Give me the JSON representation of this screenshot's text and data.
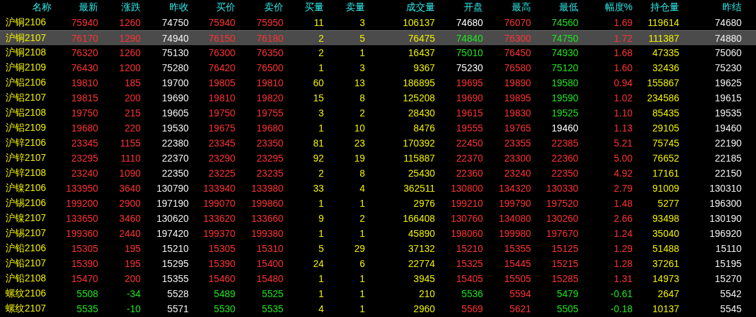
{
  "columns": [
    {
      "label": "名称",
      "kind": "name"
    },
    {
      "label": "最新",
      "kind": "price"
    },
    {
      "label": "涨跌",
      "kind": "price"
    },
    {
      "label": "昨收",
      "kind": "reference"
    },
    {
      "label": "买价",
      "kind": "price"
    },
    {
      "label": "卖价",
      "kind": "price"
    },
    {
      "label": "买量",
      "kind": "volume"
    },
    {
      "label": "卖量",
      "kind": "volume"
    },
    {
      "label": "成交量",
      "kind": "volume"
    },
    {
      "label": "开盘",
      "kind": "price"
    },
    {
      "label": "最高",
      "kind": "price"
    },
    {
      "label": "最低",
      "kind": "price"
    },
    {
      "label": "幅度%",
      "kind": "price"
    },
    {
      "label": "持仓量",
      "kind": "volume"
    },
    {
      "label": "昨结",
      "kind": "reference"
    }
  ],
  "rows": [
    {
      "selected": false,
      "cells": [
        {
          "text": "沪铜2106"
        },
        {
          "text": "75940",
          "color": "#ff3232"
        },
        {
          "text": "1260",
          "color": "#ff3232"
        },
        {
          "text": "74750"
        },
        {
          "text": "75940",
          "color": "#ff3232"
        },
        {
          "text": "75950",
          "color": "#ff3232"
        },
        {
          "text": "11"
        },
        {
          "text": "3"
        },
        {
          "text": "106137"
        },
        {
          "text": "74680",
          "color": "#ffffff"
        },
        {
          "text": "76070",
          "color": "#ff3232"
        },
        {
          "text": "74560",
          "color": "#1ee61e"
        },
        {
          "text": "1.69",
          "color": "#ff3232"
        },
        {
          "text": "119614"
        },
        {
          "text": "74680"
        }
      ]
    },
    {
      "selected": true,
      "cells": [
        {
          "text": "沪铜2107"
        },
        {
          "text": "76170",
          "color": "#ff3232"
        },
        {
          "text": "1290",
          "color": "#ff3232"
        },
        {
          "text": "74940"
        },
        {
          "text": "76150",
          "color": "#ff3232"
        },
        {
          "text": "76180",
          "color": "#ff3232"
        },
        {
          "text": "2"
        },
        {
          "text": "5"
        },
        {
          "text": "76475"
        },
        {
          "text": "74840",
          "color": "#1ee61e"
        },
        {
          "text": "76300",
          "color": "#ff3232"
        },
        {
          "text": "74750",
          "color": "#1ee61e"
        },
        {
          "text": "1.72",
          "color": "#ff3232"
        },
        {
          "text": "111387"
        },
        {
          "text": "74880"
        }
      ]
    },
    {
      "selected": false,
      "cells": [
        {
          "text": "沪铜2108"
        },
        {
          "text": "76320",
          "color": "#ff3232"
        },
        {
          "text": "1260",
          "color": "#ff3232"
        },
        {
          "text": "75130"
        },
        {
          "text": "76300",
          "color": "#ff3232"
        },
        {
          "text": "76350",
          "color": "#ff3232"
        },
        {
          "text": "2"
        },
        {
          "text": "1"
        },
        {
          "text": "16437"
        },
        {
          "text": "75010",
          "color": "#1ee61e"
        },
        {
          "text": "76450",
          "color": "#ff3232"
        },
        {
          "text": "74930",
          "color": "#1ee61e"
        },
        {
          "text": "1.68",
          "color": "#ff3232"
        },
        {
          "text": "47335"
        },
        {
          "text": "75060"
        }
      ]
    },
    {
      "selected": false,
      "cells": [
        {
          "text": "沪铜2109"
        },
        {
          "text": "76430",
          "color": "#ff3232"
        },
        {
          "text": "1200",
          "color": "#ff3232"
        },
        {
          "text": "75280"
        },
        {
          "text": "76420",
          "color": "#ff3232"
        },
        {
          "text": "76500",
          "color": "#ff3232"
        },
        {
          "text": "1"
        },
        {
          "text": "3"
        },
        {
          "text": "9367"
        },
        {
          "text": "75230",
          "color": "#ffffff"
        },
        {
          "text": "76580",
          "color": "#ff3232"
        },
        {
          "text": "75120",
          "color": "#1ee61e"
        },
        {
          "text": "1.60",
          "color": "#ff3232"
        },
        {
          "text": "32436"
        },
        {
          "text": "75230"
        }
      ]
    },
    {
      "selected": false,
      "cells": [
        {
          "text": "沪铝2106"
        },
        {
          "text": "19810",
          "color": "#ff3232"
        },
        {
          "text": "185",
          "color": "#ff3232"
        },
        {
          "text": "19700"
        },
        {
          "text": "19805",
          "color": "#ff3232"
        },
        {
          "text": "19810",
          "color": "#ff3232"
        },
        {
          "text": "60"
        },
        {
          "text": "13"
        },
        {
          "text": "186895"
        },
        {
          "text": "19695",
          "color": "#ff3232"
        },
        {
          "text": "19890",
          "color": "#ff3232"
        },
        {
          "text": "19580",
          "color": "#1ee61e"
        },
        {
          "text": "0.94",
          "color": "#ff3232"
        },
        {
          "text": "155867"
        },
        {
          "text": "19625"
        }
      ]
    },
    {
      "selected": false,
      "cells": [
        {
          "text": "沪铝2107"
        },
        {
          "text": "19815",
          "color": "#ff3232"
        },
        {
          "text": "200",
          "color": "#ff3232"
        },
        {
          "text": "19690"
        },
        {
          "text": "19810",
          "color": "#ff3232"
        },
        {
          "text": "19820",
          "color": "#ff3232"
        },
        {
          "text": "15"
        },
        {
          "text": "8"
        },
        {
          "text": "125208"
        },
        {
          "text": "19690",
          "color": "#ff3232"
        },
        {
          "text": "19895",
          "color": "#ff3232"
        },
        {
          "text": "19590",
          "color": "#1ee61e"
        },
        {
          "text": "1.02",
          "color": "#ff3232"
        },
        {
          "text": "234586"
        },
        {
          "text": "19615"
        }
      ]
    },
    {
      "selected": false,
      "cells": [
        {
          "text": "沪铝2108"
        },
        {
          "text": "19750",
          "color": "#ff3232"
        },
        {
          "text": "215",
          "color": "#ff3232"
        },
        {
          "text": "19605"
        },
        {
          "text": "19750",
          "color": "#ff3232"
        },
        {
          "text": "19755",
          "color": "#ff3232"
        },
        {
          "text": "3"
        },
        {
          "text": "2"
        },
        {
          "text": "28430"
        },
        {
          "text": "19615",
          "color": "#ff3232"
        },
        {
          "text": "19830",
          "color": "#ff3232"
        },
        {
          "text": "19525",
          "color": "#1ee61e"
        },
        {
          "text": "1.10",
          "color": "#ff3232"
        },
        {
          "text": "85435"
        },
        {
          "text": "19535"
        }
      ]
    },
    {
      "selected": false,
      "cells": [
        {
          "text": "沪铝2109"
        },
        {
          "text": "19680",
          "color": "#ff3232"
        },
        {
          "text": "220",
          "color": "#ff3232"
        },
        {
          "text": "19530"
        },
        {
          "text": "19675",
          "color": "#ff3232"
        },
        {
          "text": "19680",
          "color": "#ff3232"
        },
        {
          "text": "1"
        },
        {
          "text": "10"
        },
        {
          "text": "8476"
        },
        {
          "text": "19555",
          "color": "#ff3232"
        },
        {
          "text": "19765",
          "color": "#ff3232"
        },
        {
          "text": "19460",
          "color": "#ffffff"
        },
        {
          "text": "1.13",
          "color": "#ff3232"
        },
        {
          "text": "29105"
        },
        {
          "text": "19460"
        }
      ]
    },
    {
      "selected": false,
      "cells": [
        {
          "text": "沪锌2106"
        },
        {
          "text": "23345",
          "color": "#ff3232"
        },
        {
          "text": "1155",
          "color": "#ff3232"
        },
        {
          "text": "22380"
        },
        {
          "text": "23345",
          "color": "#ff3232"
        },
        {
          "text": "23350",
          "color": "#ff3232"
        },
        {
          "text": "81"
        },
        {
          "text": "23"
        },
        {
          "text": "170392"
        },
        {
          "text": "22450",
          "color": "#ff3232"
        },
        {
          "text": "23355",
          "color": "#ff3232"
        },
        {
          "text": "22385",
          "color": "#ff3232"
        },
        {
          "text": "5.21",
          "color": "#ff3232"
        },
        {
          "text": "75745"
        },
        {
          "text": "22190"
        }
      ]
    },
    {
      "selected": false,
      "cells": [
        {
          "text": "沪锌2107"
        },
        {
          "text": "23295",
          "color": "#ff3232"
        },
        {
          "text": "1110",
          "color": "#ff3232"
        },
        {
          "text": "22370"
        },
        {
          "text": "23290",
          "color": "#ff3232"
        },
        {
          "text": "23295",
          "color": "#ff3232"
        },
        {
          "text": "92"
        },
        {
          "text": "19"
        },
        {
          "text": "115887"
        },
        {
          "text": "22370",
          "color": "#ff3232"
        },
        {
          "text": "23300",
          "color": "#ff3232"
        },
        {
          "text": "22360",
          "color": "#ff3232"
        },
        {
          "text": "5.00",
          "color": "#ff3232"
        },
        {
          "text": "76652"
        },
        {
          "text": "22185"
        }
      ]
    },
    {
      "selected": false,
      "cells": [
        {
          "text": "沪锌2108"
        },
        {
          "text": "23240",
          "color": "#ff3232"
        },
        {
          "text": "1090",
          "color": "#ff3232"
        },
        {
          "text": "22350"
        },
        {
          "text": "23225",
          "color": "#ff3232"
        },
        {
          "text": "23235",
          "color": "#ff3232"
        },
        {
          "text": "2"
        },
        {
          "text": "8"
        },
        {
          "text": "25430"
        },
        {
          "text": "22360",
          "color": "#ff3232"
        },
        {
          "text": "23240",
          "color": "#ff3232"
        },
        {
          "text": "22350",
          "color": "#ff3232"
        },
        {
          "text": "4.92",
          "color": "#ff3232"
        },
        {
          "text": "17161"
        },
        {
          "text": "22150"
        }
      ]
    },
    {
      "selected": false,
      "cells": [
        {
          "text": "沪镍2106"
        },
        {
          "text": "133950",
          "color": "#ff3232"
        },
        {
          "text": "3640",
          "color": "#ff3232"
        },
        {
          "text": "130790"
        },
        {
          "text": "133940",
          "color": "#ff3232"
        },
        {
          "text": "133980",
          "color": "#ff3232"
        },
        {
          "text": "33"
        },
        {
          "text": "4"
        },
        {
          "text": "362511"
        },
        {
          "text": "130800",
          "color": "#ff3232"
        },
        {
          "text": "134320",
          "color": "#ff3232"
        },
        {
          "text": "130330",
          "color": "#ff3232"
        },
        {
          "text": "2.79",
          "color": "#ff3232"
        },
        {
          "text": "91009"
        },
        {
          "text": "130310"
        }
      ]
    },
    {
      "selected": false,
      "cells": [
        {
          "text": "沪锡2106"
        },
        {
          "text": "199200",
          "color": "#ff3232"
        },
        {
          "text": "2900",
          "color": "#ff3232"
        },
        {
          "text": "197190"
        },
        {
          "text": "199070",
          "color": "#ff3232"
        },
        {
          "text": "199860",
          "color": "#ff3232"
        },
        {
          "text": "1"
        },
        {
          "text": "1"
        },
        {
          "text": "2976"
        },
        {
          "text": "199210",
          "color": "#ff3232"
        },
        {
          "text": "199790",
          "color": "#ff3232"
        },
        {
          "text": "197520",
          "color": "#ff3232"
        },
        {
          "text": "1.48",
          "color": "#ff3232"
        },
        {
          "text": "5277"
        },
        {
          "text": "196300"
        }
      ]
    },
    {
      "selected": false,
      "cells": [
        {
          "text": "沪镍2107"
        },
        {
          "text": "133650",
          "color": "#ff3232"
        },
        {
          "text": "3460",
          "color": "#ff3232"
        },
        {
          "text": "130620"
        },
        {
          "text": "133620",
          "color": "#ff3232"
        },
        {
          "text": "133660",
          "color": "#ff3232"
        },
        {
          "text": "9"
        },
        {
          "text": "2"
        },
        {
          "text": "166408"
        },
        {
          "text": "130760",
          "color": "#ff3232"
        },
        {
          "text": "134080",
          "color": "#ff3232"
        },
        {
          "text": "130260",
          "color": "#ff3232"
        },
        {
          "text": "2.66",
          "color": "#ff3232"
        },
        {
          "text": "93498"
        },
        {
          "text": "130190"
        }
      ]
    },
    {
      "selected": false,
      "cells": [
        {
          "text": "沪锡2107"
        },
        {
          "text": "199360",
          "color": "#ff3232"
        },
        {
          "text": "2440",
          "color": "#ff3232"
        },
        {
          "text": "197420"
        },
        {
          "text": "199370",
          "color": "#ff3232"
        },
        {
          "text": "199380",
          "color": "#ff3232"
        },
        {
          "text": "1"
        },
        {
          "text": "1"
        },
        {
          "text": "45890"
        },
        {
          "text": "198060",
          "color": "#ff3232"
        },
        {
          "text": "199980",
          "color": "#ff3232"
        },
        {
          "text": "197670",
          "color": "#ff3232"
        },
        {
          "text": "1.24",
          "color": "#ff3232"
        },
        {
          "text": "35040"
        },
        {
          "text": "196920"
        }
      ]
    },
    {
      "selected": false,
      "cells": [
        {
          "text": "沪铅2106"
        },
        {
          "text": "15305",
          "color": "#ff3232"
        },
        {
          "text": "195",
          "color": "#ff3232"
        },
        {
          "text": "15210"
        },
        {
          "text": "15305",
          "color": "#ff3232"
        },
        {
          "text": "15310",
          "color": "#ff3232"
        },
        {
          "text": "5"
        },
        {
          "text": "29"
        },
        {
          "text": "37132"
        },
        {
          "text": "15210",
          "color": "#ff3232"
        },
        {
          "text": "15355",
          "color": "#ff3232"
        },
        {
          "text": "15125",
          "color": "#ff3232"
        },
        {
          "text": "1.29",
          "color": "#ff3232"
        },
        {
          "text": "51488"
        },
        {
          "text": "15110"
        }
      ]
    },
    {
      "selected": false,
      "cells": [
        {
          "text": "沪铅2107"
        },
        {
          "text": "15390",
          "color": "#ff3232"
        },
        {
          "text": "195",
          "color": "#ff3232"
        },
        {
          "text": "15295"
        },
        {
          "text": "15390",
          "color": "#ff3232"
        },
        {
          "text": "15400",
          "color": "#ff3232"
        },
        {
          "text": "24"
        },
        {
          "text": "6"
        },
        {
          "text": "22774"
        },
        {
          "text": "15325",
          "color": "#ff3232"
        },
        {
          "text": "15445",
          "color": "#ff3232"
        },
        {
          "text": "15215",
          "color": "#ff3232"
        },
        {
          "text": "1.28",
          "color": "#ff3232"
        },
        {
          "text": "37261"
        },
        {
          "text": "15195"
        }
      ]
    },
    {
      "selected": false,
      "cells": [
        {
          "text": "沪铅2108"
        },
        {
          "text": "15470",
          "color": "#ff3232"
        },
        {
          "text": "200",
          "color": "#ff3232"
        },
        {
          "text": "15355"
        },
        {
          "text": "15460",
          "color": "#ff3232"
        },
        {
          "text": "15480",
          "color": "#ff3232"
        },
        {
          "text": "1"
        },
        {
          "text": "1"
        },
        {
          "text": "3945"
        },
        {
          "text": "15405",
          "color": "#ff3232"
        },
        {
          "text": "15505",
          "color": "#ff3232"
        },
        {
          "text": "15285",
          "color": "#ff3232"
        },
        {
          "text": "1.31",
          "color": "#ff3232"
        },
        {
          "text": "14973"
        },
        {
          "text": "15270"
        }
      ]
    },
    {
      "selected": false,
      "cells": [
        {
          "text": "螺纹2106"
        },
        {
          "text": "5508",
          "color": "#1ee61e"
        },
        {
          "text": "-34",
          "color": "#1ee61e"
        },
        {
          "text": "5528"
        },
        {
          "text": "5489",
          "color": "#1ee61e"
        },
        {
          "text": "5525",
          "color": "#1ee61e"
        },
        {
          "text": "1"
        },
        {
          "text": "1"
        },
        {
          "text": "210"
        },
        {
          "text": "5536",
          "color": "#1ee61e"
        },
        {
          "text": "5594",
          "color": "#ff3232"
        },
        {
          "text": "5479",
          "color": "#1ee61e"
        },
        {
          "text": "-0.61",
          "color": "#1ee61e"
        },
        {
          "text": "2647"
        },
        {
          "text": "5542"
        }
      ]
    },
    {
      "selected": false,
      "cells": [
        {
          "text": "螺纹2107"
        },
        {
          "text": "5535",
          "color": "#1ee61e"
        },
        {
          "text": "-10",
          "color": "#1ee61e"
        },
        {
          "text": "5571"
        },
        {
          "text": "5530",
          "color": "#1ee61e"
        },
        {
          "text": "5535",
          "color": "#1ee61e"
        },
        {
          "text": "4"
        },
        {
          "text": "1"
        },
        {
          "text": "2960"
        },
        {
          "text": "5569",
          "color": "#ff3232"
        },
        {
          "text": "5621",
          "color": "#ff3232"
        },
        {
          "text": "5505",
          "color": "#1ee61e"
        },
        {
          "text": "-0.18",
          "color": "#1ee61e"
        },
        {
          "text": "10137"
        },
        {
          "text": "5545"
        }
      ]
    }
  ]
}
